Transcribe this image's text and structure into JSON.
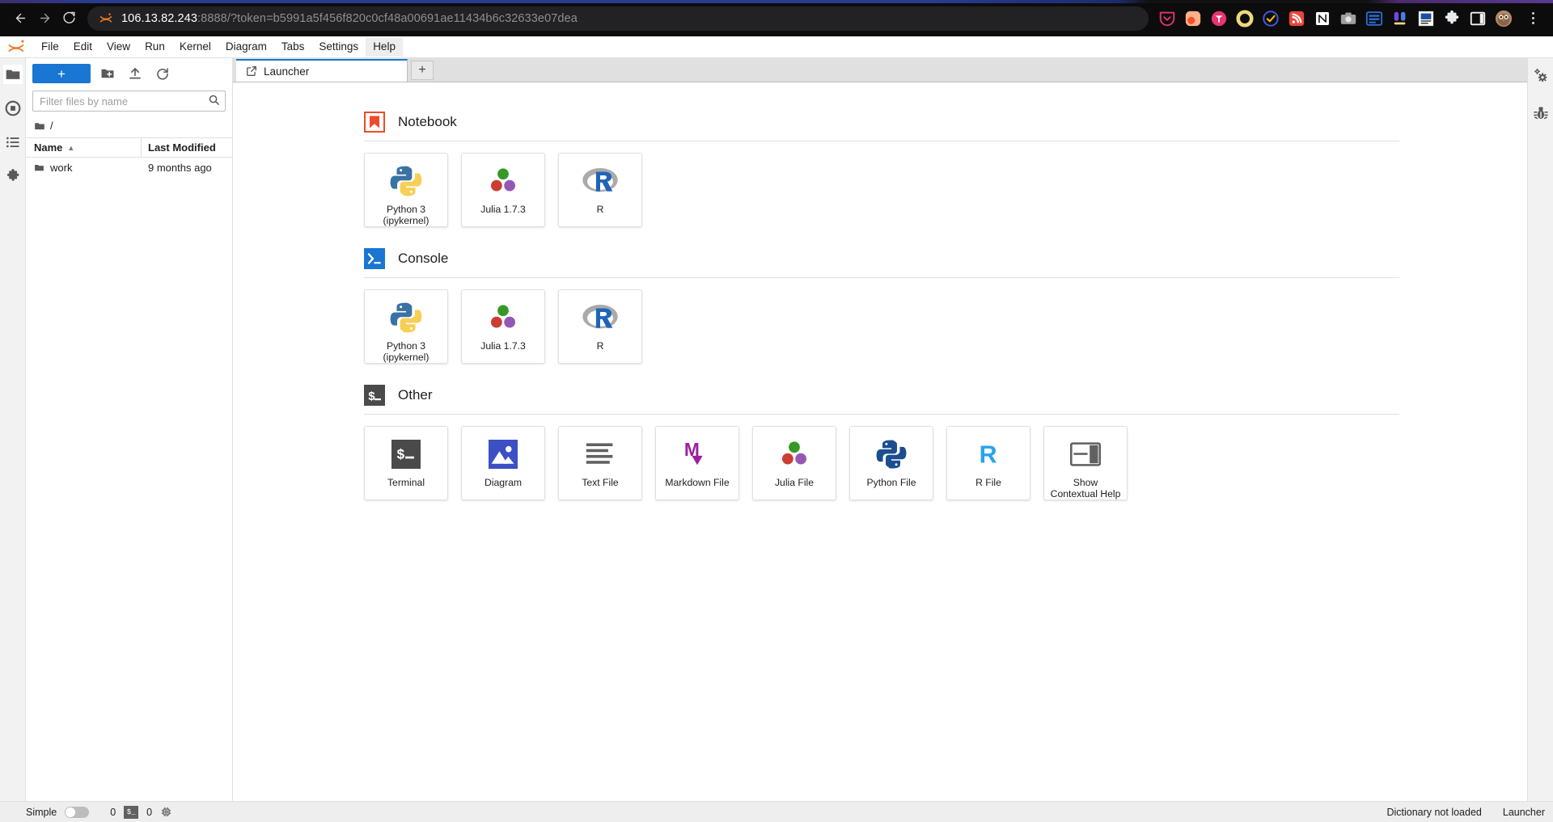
{
  "browser": {
    "back_label": "←",
    "forward_label": "→",
    "reload_label": "⟳",
    "url_host": "106.13.82.243",
    "url_rest": ":8888/?token=b5991a5f456f820c0cf48a00691ae11434b6c32633e07dea",
    "site_icon": "jupyter-favicon",
    "extensions": [
      {
        "name": "pocket-extension-icon",
        "color": "#d6336c"
      },
      {
        "name": "rss-bubble-extension-icon",
        "color": "#f4845f"
      },
      {
        "name": "tampermonkey-extension-icon",
        "color": "#e8336d"
      },
      {
        "name": "ring-extension-icon",
        "color": "#f0d77b"
      },
      {
        "name": "todoist-check-extension-icon",
        "color": "#3b5bdb"
      },
      {
        "name": "feedly-rss-extension-icon",
        "color": "#e8453c"
      },
      {
        "name": "notion-web-clipper-extension-icon",
        "color": "#ffffff"
      },
      {
        "name": "screenshot-camera-extension-icon",
        "color": "#9e9e9e"
      },
      {
        "name": "reader-view-extension-icon",
        "color": "#2b6cd4"
      },
      {
        "name": "people-extension-icon",
        "color": "#7048e8"
      },
      {
        "name": "dictionary-extension-icon",
        "color": "#1c4fa0"
      },
      {
        "name": "puzzle-extensions-icon",
        "color": "#e9ecef"
      },
      {
        "name": "sidebar-toggle-icon",
        "color": "#ffffff"
      },
      {
        "name": "owl-profile-avatar",
        "color": "#b08968"
      }
    ],
    "menu_label": "browser-menu"
  },
  "menubar": {
    "logo": "jupyter-logo",
    "items": [
      {
        "label": "File",
        "active": false
      },
      {
        "label": "Edit",
        "active": false
      },
      {
        "label": "View",
        "active": false
      },
      {
        "label": "Run",
        "active": false
      },
      {
        "label": "Kernel",
        "active": false
      },
      {
        "label": "Diagram",
        "active": false
      },
      {
        "label": "Tabs",
        "active": false
      },
      {
        "label": "Settings",
        "active": false
      },
      {
        "label": "Help",
        "active": true
      }
    ]
  },
  "left_rail": {
    "items": [
      {
        "name": "file-browser-icon",
        "selected": true
      },
      {
        "name": "running-terminals-icon",
        "selected": false
      },
      {
        "name": "table-of-contents-icon",
        "selected": false
      },
      {
        "name": "extension-manager-icon",
        "selected": false
      }
    ]
  },
  "file_browser": {
    "new_launcher_label": "+",
    "new_folder_icon": "new-folder-icon",
    "upload_icon": "upload-icon",
    "refresh_icon": "refresh-icon",
    "filter_placeholder": "Filter files by name",
    "filter_value": "",
    "breadcrumb_root": "/",
    "columns": [
      "Name",
      "Last Modified"
    ],
    "sort_column": "Name",
    "sort_direction": "asc",
    "rows": [
      {
        "name": "work",
        "modified": "9 months ago",
        "type": "folder"
      }
    ]
  },
  "tab_bar": {
    "tabs": [
      {
        "label": "Launcher",
        "icon": "launcher-icon",
        "active": true
      }
    ],
    "add_tab_label": "+"
  },
  "launcher": {
    "sections": [
      {
        "id": "notebook",
        "title": "Notebook",
        "badge": "notebook-bookmark-icon",
        "badge_color": "#ee4b2b",
        "cards": [
          {
            "label": "Python 3\n(ipykernel)",
            "icon": "python-logo-icon"
          },
          {
            "label": "Julia 1.7.3",
            "icon": "julia-logo-icon"
          },
          {
            "label": "R",
            "icon": "r-logo-icon"
          }
        ]
      },
      {
        "id": "console",
        "title": "Console",
        "badge": "console-prompt-icon",
        "badge_color": "#1976d2",
        "cards": [
          {
            "label": "Python 3\n(ipykernel)",
            "icon": "python-logo-icon"
          },
          {
            "label": "Julia 1.7.3",
            "icon": "julia-logo-icon"
          },
          {
            "label": "R",
            "icon": "r-logo-icon"
          }
        ]
      },
      {
        "id": "other",
        "title": "Other",
        "badge": "terminal-prompt-icon",
        "badge_color": "#4a4a4a",
        "cards": [
          {
            "label": "Terminal",
            "icon": "terminal-icon"
          },
          {
            "label": "Diagram",
            "icon": "diagram-image-icon"
          },
          {
            "label": "Text File",
            "icon": "text-file-icon"
          },
          {
            "label": "Markdown File",
            "icon": "markdown-file-icon"
          },
          {
            "label": "Julia File",
            "icon": "julia-logo-icon"
          },
          {
            "label": "Python File",
            "icon": "python-mono-icon"
          },
          {
            "label": "R File",
            "icon": "r-letter-icon"
          },
          {
            "label": "Show\nContextual Help",
            "icon": "contextual-help-icon"
          }
        ]
      }
    ]
  },
  "right_rail": {
    "items": [
      {
        "name": "property-inspector-icon"
      },
      {
        "name": "debugger-bug-icon"
      }
    ]
  },
  "status_bar": {
    "simple_label": "Simple",
    "simple_enabled": false,
    "kernel_count": "0",
    "terminal_chip": "$_",
    "terminal_count": "0",
    "cpu_icon": "cpu-chip-icon",
    "dictionary_status": "Dictionary not loaded",
    "current_view": "Launcher"
  },
  "colors": {
    "accent_blue": "#1976d2",
    "notebook_orange": "#ee4b2b",
    "chrome_dark": "#0c0c0c"
  }
}
